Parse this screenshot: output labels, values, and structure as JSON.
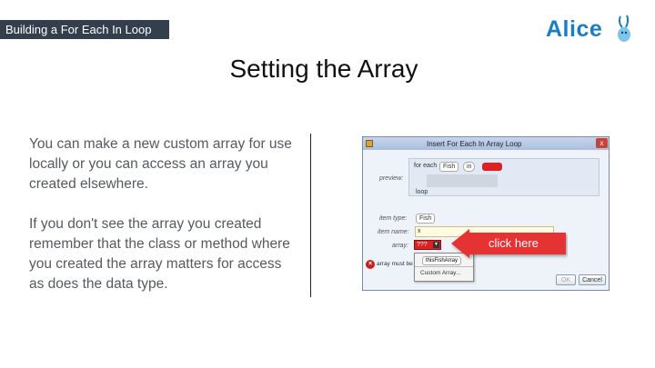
{
  "header": {
    "section_label": "Building a For Each In Loop",
    "logo_text": "Alice"
  },
  "slide": {
    "title": "Setting the Array",
    "paragraph1": "You can make a new custom array for use locally or you can access an array you created elsewhere.",
    "paragraph2": "If you don't see the array you created remember that the class or method where you created the array matters for access as does the data type."
  },
  "dialog": {
    "title": "Insert For Each In Array Loop",
    "close_label": "x",
    "preview_label": "preview:",
    "preview_for_each": "for each",
    "preview_type_chip": "Fish",
    "preview_in_chip": "in",
    "preview_loop": "loop",
    "item_type_label": "item type:",
    "item_type_value": "Fish",
    "item_name_label": "item name:",
    "item_name_value": "x",
    "array_label": "array:",
    "array_value": "???",
    "array_error": "array must be set",
    "menu_item1": "thisFishArray",
    "menu_item2": "Custom Array...",
    "ok_label": "OK",
    "cancel_label": "Cancel"
  },
  "callout": {
    "text": "click here",
    "color": "#e53030"
  },
  "colors": {
    "header_bg": "#333f4d",
    "logo_blue": "#1a7fc1"
  }
}
